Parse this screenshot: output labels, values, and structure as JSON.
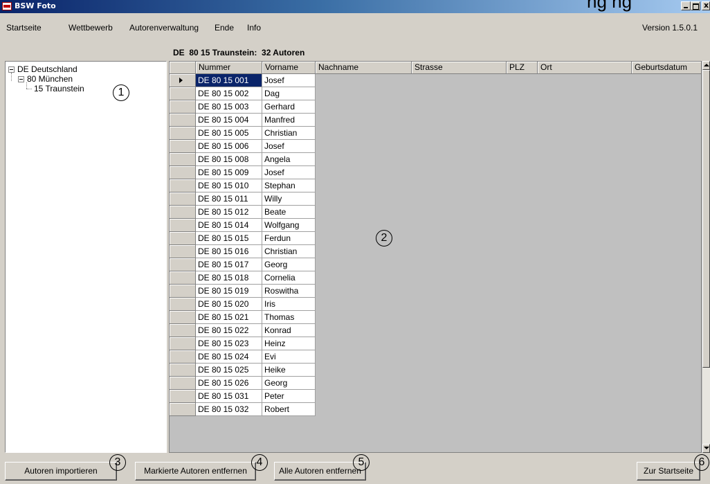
{
  "window": {
    "title": "BSW Foto",
    "overlay_text": "ng ng",
    "app_icon": "bsw-foto-app-icon"
  },
  "menu": {
    "items": [
      "Startseite",
      "Wettbewerb",
      "Autorenverwaltung",
      "Ende",
      "Info"
    ],
    "version": "Version 1.5.0.1"
  },
  "tree": {
    "nodes": [
      "DE Deutschland",
      "80 München",
      "15 Traunstein"
    ]
  },
  "grid": {
    "title": "DE  80 15 Traunstein:  32 Autoren",
    "columns": [
      "Nummer",
      "Vorname",
      "Nachname",
      "Strasse",
      "PLZ",
      "Ort",
      "Geburtsdatum"
    ],
    "rows": [
      {
        "nummer": "DE 80 15 001",
        "vorname": "Josef"
      },
      {
        "nummer": "DE 80 15 002",
        "vorname": "Dag"
      },
      {
        "nummer": "DE 80 15 003",
        "vorname": "Gerhard"
      },
      {
        "nummer": "DE 80 15 004",
        "vorname": "Manfred"
      },
      {
        "nummer": "DE 80 15 005",
        "vorname": "Christian"
      },
      {
        "nummer": "DE 80 15 006",
        "vorname": "Josef"
      },
      {
        "nummer": "DE 80 15 008",
        "vorname": "Angela"
      },
      {
        "nummer": "DE 80 15 009",
        "vorname": "Josef"
      },
      {
        "nummer": "DE 80 15 010",
        "vorname": "Stephan"
      },
      {
        "nummer": "DE 80 15 011",
        "vorname": "Willy"
      },
      {
        "nummer": "DE 80 15 012",
        "vorname": "Beate"
      },
      {
        "nummer": "DE 80 15 014",
        "vorname": "Wolfgang"
      },
      {
        "nummer": "DE 80 15 015",
        "vorname": "Ferdun"
      },
      {
        "nummer": "DE 80 15 016",
        "vorname": "Christian"
      },
      {
        "nummer": "DE 80 15 017",
        "vorname": "Georg"
      },
      {
        "nummer": "DE 80 15 018",
        "vorname": "Cornelia"
      },
      {
        "nummer": "DE 80 15 019",
        "vorname": "Roswitha"
      },
      {
        "nummer": "DE 80 15 020",
        "vorname": "Iris"
      },
      {
        "nummer": "DE 80 15 021",
        "vorname": "Thomas"
      },
      {
        "nummer": "DE 80 15 022",
        "vorname": "Konrad"
      },
      {
        "nummer": "DE 80 15 023",
        "vorname": "Heinz"
      },
      {
        "nummer": "DE 80 15 024",
        "vorname": "Evi"
      },
      {
        "nummer": "DE 80 15 025",
        "vorname": "Heike"
      },
      {
        "nummer": "DE 80 15 026",
        "vorname": "Georg"
      },
      {
        "nummer": "DE 80 15 031",
        "vorname": "Peter"
      },
      {
        "nummer": "DE 80 15 032",
        "vorname": "Robert"
      }
    ],
    "selected_row": 0
  },
  "buttons": {
    "import": "Autoren importieren",
    "remove_marked": "Markierte Autoren entfernen",
    "remove_all": "Alle Autoren entfernen",
    "to_start": "Zur Startseite"
  },
  "markers": [
    "1",
    "2",
    "3",
    "4",
    "5",
    "6"
  ],
  "colors": {
    "selection": "#0a246a",
    "title_bar_start": "#0a246a",
    "title_bar_end": "#a6caf0",
    "window_background": "#d4d0c8"
  }
}
